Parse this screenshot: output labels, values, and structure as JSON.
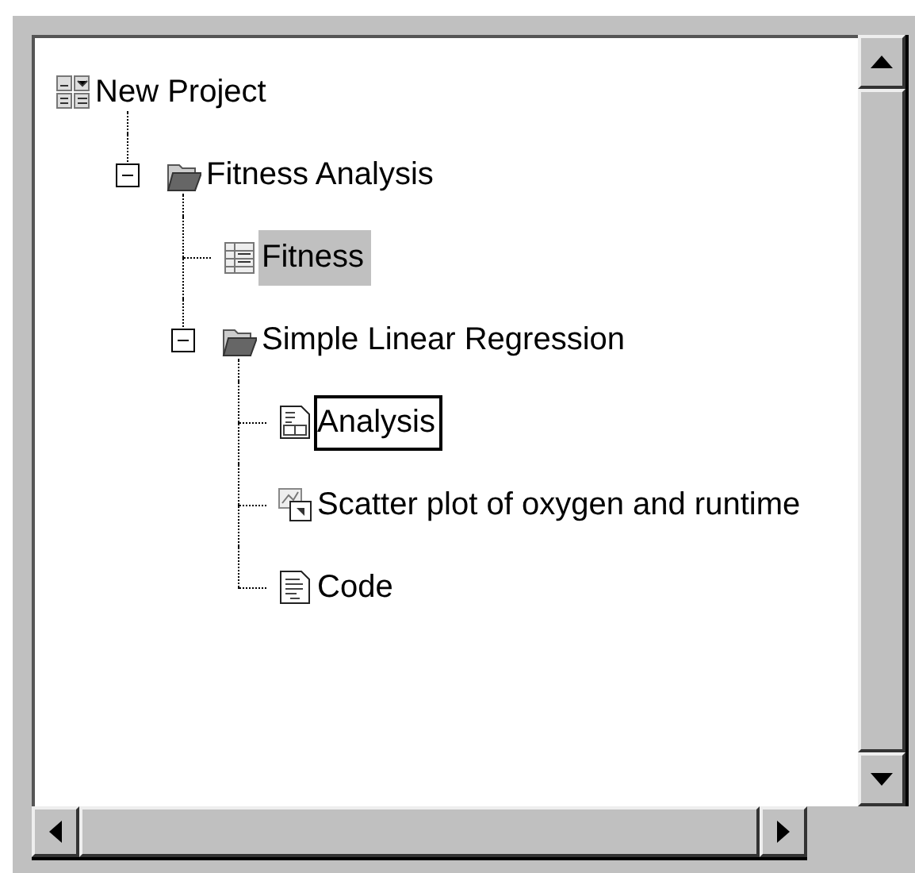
{
  "tree": [
    {
      "label": "New Project",
      "kind": "project",
      "selected": false,
      "focused": false,
      "children": [
        {
          "label": "Fitness Analysis",
          "kind": "folder",
          "selected": false,
          "focused": false,
          "expanded": true,
          "children": [
            {
              "label": "Fitness",
              "kind": "table",
              "selected": true,
              "focused": false
            },
            {
              "label": "Simple Linear Regression",
              "kind": "folder",
              "selected": false,
              "focused": false,
              "expanded": true,
              "children": [
                {
                  "label": "Analysis",
                  "kind": "report",
                  "selected": false,
                  "focused": true
                },
                {
                  "label": "Scatter plot of oxygen and runtime",
                  "kind": "graph",
                  "selected": false,
                  "focused": false
                },
                {
                  "label": "Code",
                  "kind": "code",
                  "selected": false,
                  "focused": false
                }
              ]
            }
          ]
        }
      ]
    }
  ]
}
